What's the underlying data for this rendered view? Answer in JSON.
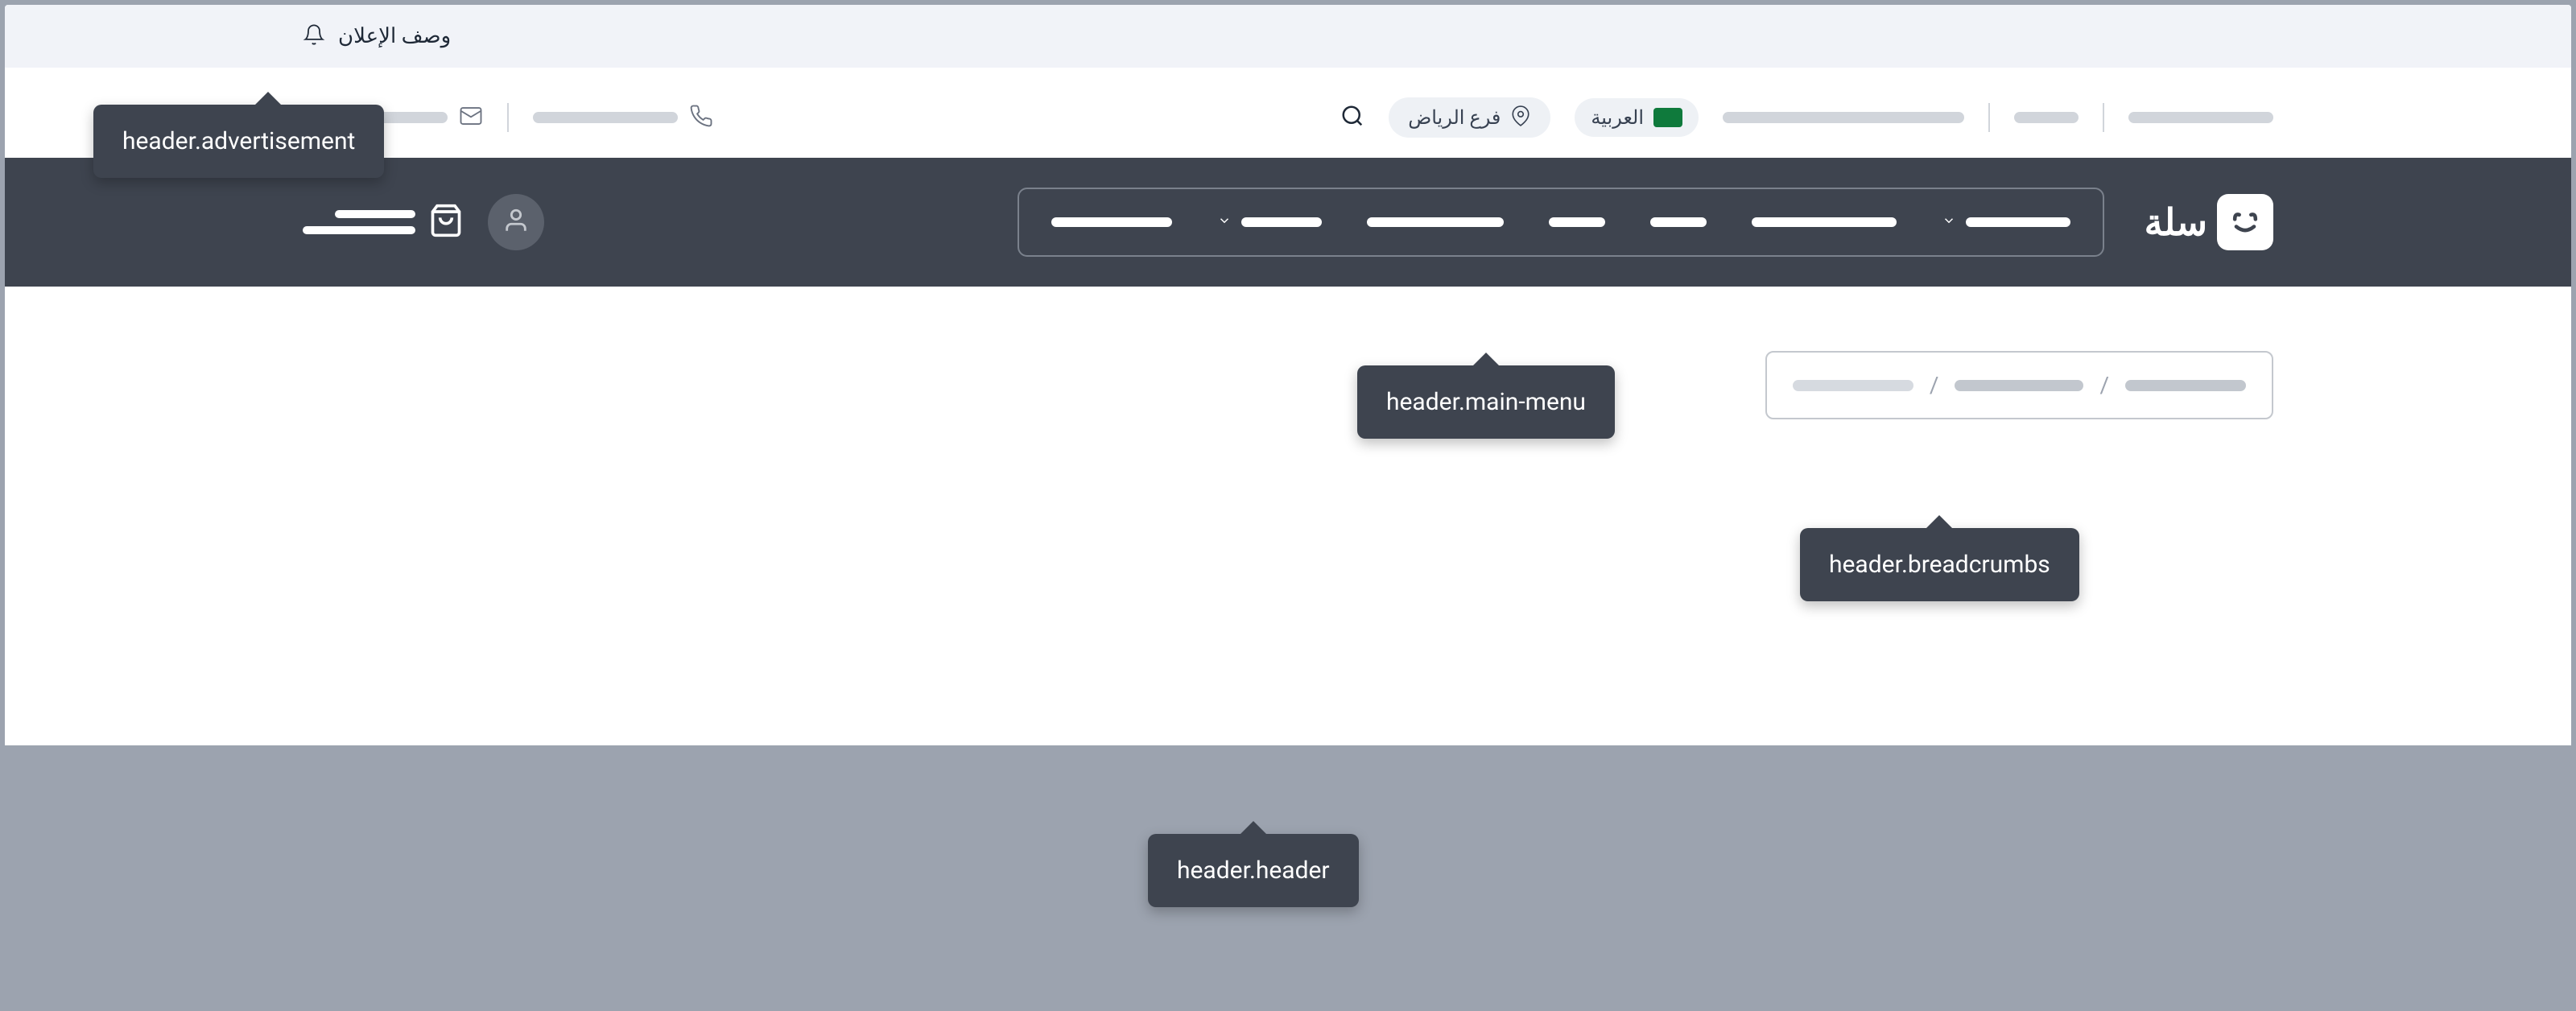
{
  "advertisement": {
    "text": "وصف الإعلان"
  },
  "topbar": {
    "language": "العربية",
    "branch": "فرع الرياض",
    "flag_code": "SA"
  },
  "logo": {
    "text": "سلة"
  },
  "tooltips": {
    "advertisement": "header.advertisement",
    "main_menu": "header.main-menu",
    "breadcrumbs": "header.breadcrumbs",
    "header": "header.header"
  },
  "breadcrumb_separator": "/"
}
